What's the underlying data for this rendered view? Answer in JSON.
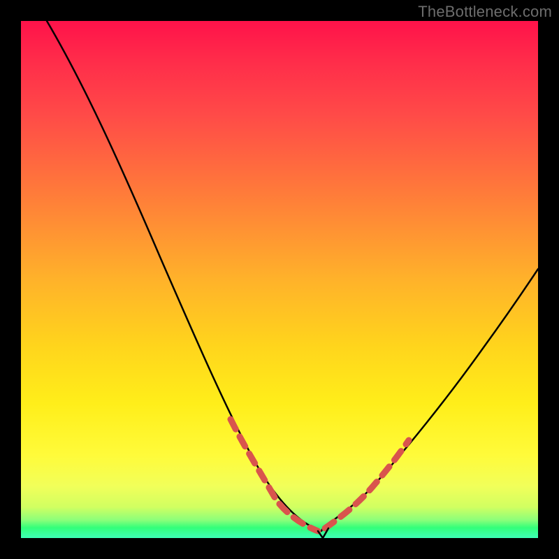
{
  "watermark": "TheBottleneck.com",
  "colors": {
    "background": "#000000",
    "curve_stroke": "#000000",
    "dash_stroke": "#d9544d",
    "gradient_top": "#ff124a",
    "gradient_bottom": "#3effb6"
  },
  "chart_data": {
    "type": "line",
    "title": "",
    "xlabel": "",
    "ylabel": "",
    "xlim": [
      0,
      100
    ],
    "ylim": [
      0,
      100
    ],
    "x": [
      5,
      10,
      15,
      20,
      25,
      30,
      35,
      40,
      42,
      45,
      48,
      50,
      52,
      55,
      58,
      60,
      63,
      66,
      70,
      75,
      80,
      85,
      90,
      95,
      100
    ],
    "values": [
      100,
      92,
      83,
      73,
      63,
      53,
      43,
      32,
      27,
      20,
      13,
      8,
      4,
      2,
      1,
      1.5,
      3,
      6,
      11,
      19,
      27,
      35,
      42,
      49,
      55
    ],
    "annotations": {
      "dashed_region_x": [
        40,
        70
      ],
      "dashed_region_y_max": 27,
      "notch_minimum_x": 58,
      "notch_minimum_y": 1
    }
  }
}
